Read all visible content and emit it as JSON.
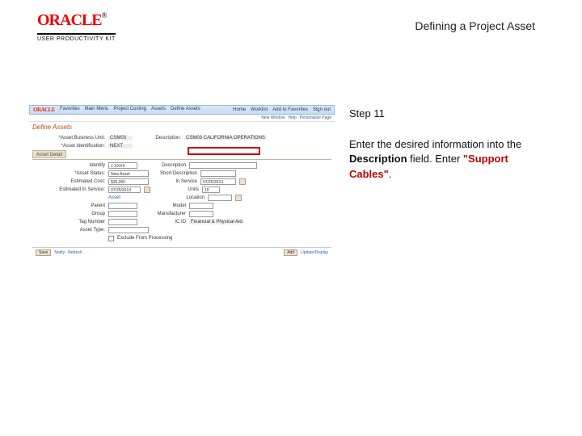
{
  "header": {
    "brand": "ORACLE",
    "tm": "®",
    "upk": "USER PRODUCTIVITY KIT"
  },
  "title": "Defining a Project Asset",
  "instruction": {
    "step_label": "Step 11",
    "sentence1_a": "Enter the desired information into the ",
    "field_name": "Description",
    "sentence1_b": " field. Enter ",
    "value": "\"Support Cables\"",
    "sentence1_c": "."
  },
  "shot": {
    "tabs": {
      "t1": "Favorites",
      "t2": "Main Menu",
      "t3": "Project Costing",
      "t4": "Assets",
      "t5": "Define Assets"
    },
    "tabright": {
      "r1": "Home",
      "r2": "Worklist",
      "r3": "Add to Favorites",
      "r4": "Sign out"
    },
    "crumbs": {
      "new_window": "New Window",
      "help": "Help",
      "personalize": "Personalize Page"
    },
    "section": "Define Assets",
    "oracle": "ORACLE",
    "tab_asset_detail": "Asset Detail",
    "labels": {
      "bu": "*Asset Business Unit:",
      "asset_id": "*Asset Identification:",
      "description_side": "Description:",
      "identify": "Identify",
      "description": "Description",
      "short_desc": "Short Description",
      "asset_status": "*Asset Status:",
      "estimated_cost": "Estimated Cost:",
      "estimated_inservice": "Estimated In Service:",
      "units": "Units",
      "location": "Location",
      "inservice": "In Service",
      "parent": "Parent",
      "model": "Model",
      "group": "Group",
      "manufacturer": "Manufacturer",
      "tag": "Tag Number",
      "asset_type": "Asset Type:",
      "exclude": "Exclude From Processing",
      "ic_id": "IC ID",
      "icid_desc": "Financial & Physical Aid",
      "asset_link": "Asset"
    },
    "values": {
      "bu": "CSM03",
      "bu_desc": "CSM03 CALIFORNIA OPERATIONS",
      "asset_id": "NEXT",
      "identify": "1-XXXX",
      "asset_status": "New Asset",
      "estimated_cost": "$35,000",
      "est_inservice": "07/25/2013",
      "units": "10",
      "inservice": "07/25/2013"
    },
    "bottom": {
      "save": "Save",
      "notify": "Notify",
      "refresh": "Refresh",
      "add": "Add",
      "update": "Update/Display"
    }
  }
}
